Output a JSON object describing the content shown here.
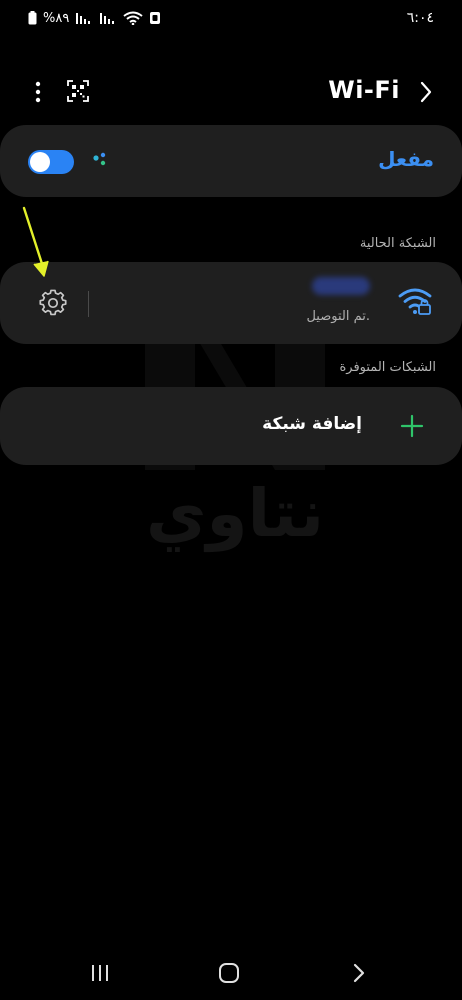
{
  "status_bar": {
    "time": "٦:٠٤",
    "battery": "%٨٩"
  },
  "header": {
    "title": "Wi-Fi"
  },
  "wifi_toggle": {
    "label": "مفعل",
    "enabled": true
  },
  "current_network": {
    "section_label": "الشبكة الحالية",
    "status": "تم التوصيل."
  },
  "available_networks": {
    "section_label": "الشبكات المتوفرة",
    "add_label": "إضافة شبكة"
  },
  "watermark": {
    "text": "نتاوي",
    "letter": "N"
  },
  "colors": {
    "accent": "#3b8ff2",
    "toggle_track": "#2a83f4",
    "plus": "#2fc46a",
    "card_bg": "#1f1f1f",
    "arrow": "#e3f02a"
  }
}
